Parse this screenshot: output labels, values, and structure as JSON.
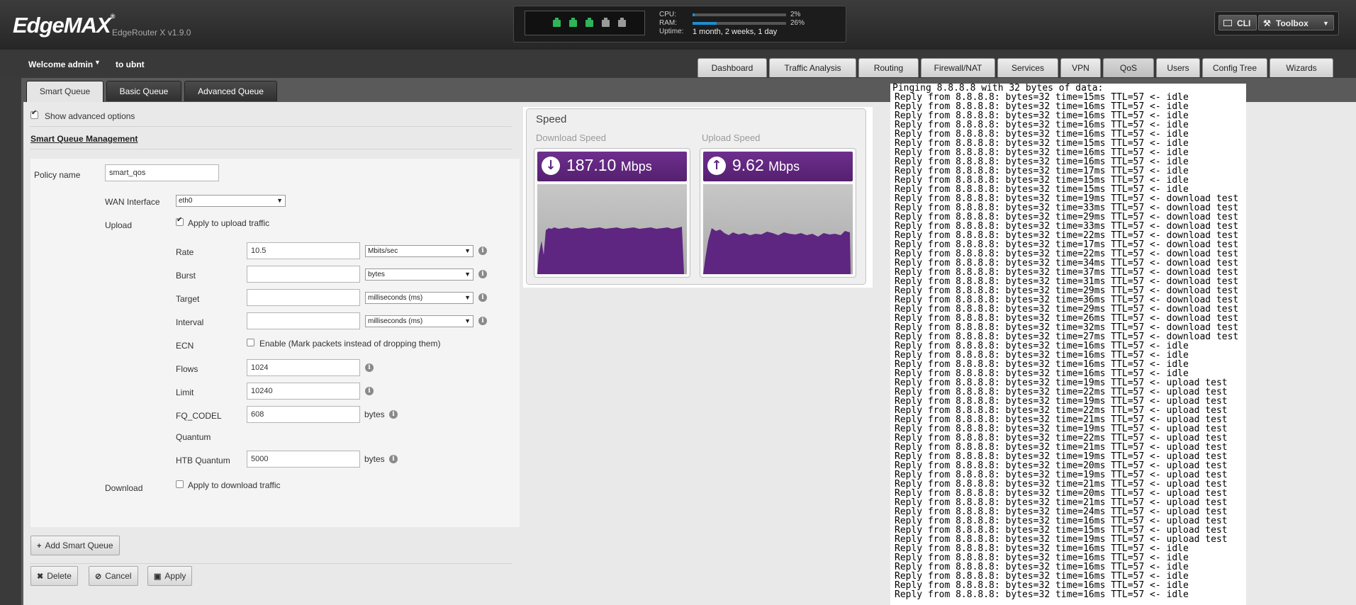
{
  "header": {
    "logo_text": "EdgeMAX",
    "logo_sup": "®",
    "device": "EdgeRouter X v1.9.0",
    "stats": {
      "cpu_label": "CPU:",
      "cpu_pct": "2%",
      "cpu_value": 0.02,
      "ram_label": "RAM:",
      "ram_pct": "26%",
      "ram_value": 0.26,
      "uptime_label": "Uptime:",
      "uptime_value": "1 month, 2 weeks, 1 day"
    },
    "ports": [
      {
        "name": "eth0",
        "color": "#2fb35b"
      },
      {
        "name": "eth1",
        "color": "#2fb35b"
      },
      {
        "name": "eth2",
        "color": "#2fb35b"
      },
      {
        "name": "eth3",
        "color": "#9a9a9a"
      },
      {
        "name": "eth4",
        "color": "#9a9a9a"
      }
    ],
    "cli_label": "CLI",
    "toolbox_label": "Toolbox"
  },
  "subbar": {
    "welcome": "Welcome admin",
    "user_link": "to ubnt",
    "tabs": [
      "Dashboard",
      "Traffic Analysis",
      "Routing",
      "Firewall/NAT",
      "Services",
      "VPN",
      "QoS",
      "Users",
      "Config Tree",
      "Wizards"
    ],
    "active_tab": "QoS"
  },
  "queue_tabs": [
    "Smart Queue",
    "Basic Queue",
    "Advanced Queue"
  ],
  "form": {
    "show_advanced": "Show advanced options",
    "section_title": "Smart Queue Management",
    "policy_label": "Policy name",
    "policy_value": "smart_qos",
    "wan_label": "WAN Interface",
    "wan_value": "eth0",
    "upload_label": "Upload",
    "upload_apply": "Apply to upload traffic",
    "rate_label": "Rate",
    "rate_value": "10.5",
    "rate_unit": "Mbits/sec",
    "burst_label": "Burst",
    "burst_value": "",
    "burst_unit": "bytes",
    "target_label": "Target",
    "target_value": "",
    "target_unit": "milliseconds (ms)",
    "interval_label": "Interval",
    "interval_value": "",
    "interval_unit": "milliseconds (ms)",
    "ecn_label": "ECN",
    "ecn_text": "Enable (Mark packets instead of dropping them)",
    "flows_label": "Flows",
    "flows_value": "1024",
    "limit_label": "Limit",
    "limit_value": "10240",
    "fq_label_1": "FQ_CODEL",
    "fq_label_2": "Quantum",
    "fq_value": "608",
    "fq_unit": "bytes",
    "htb_label": "HTB Quantum",
    "htb_value": "5000",
    "htb_unit": "bytes",
    "download_label": "Download",
    "download_apply": "Apply to download traffic",
    "add_button": "Add Smart Queue",
    "delete_button": "Delete",
    "cancel_button": "Cancel",
    "apply_button": "Apply"
  },
  "speed": {
    "title": "Speed",
    "download_title": "Download Speed",
    "download_value": "187.10",
    "download_unit": "Mbps",
    "upload_title": "Upload Speed",
    "upload_value": "9.62",
    "upload_unit": "Mbps",
    "graph_color": "#5e2680"
  },
  "ping_log": {
    "header": "Pinging 8.8.8.8 with 32 bytes of data:",
    "lines": [
      {
        "time": "15ms",
        "tag": "idle"
      },
      {
        "time": "16ms",
        "tag": "idle"
      },
      {
        "time": "16ms",
        "tag": "idle"
      },
      {
        "time": "16ms",
        "tag": "idle"
      },
      {
        "time": "16ms",
        "tag": "idle"
      },
      {
        "time": "15ms",
        "tag": "idle"
      },
      {
        "time": "16ms",
        "tag": "idle"
      },
      {
        "time": "16ms",
        "tag": "idle"
      },
      {
        "time": "17ms",
        "tag": "idle"
      },
      {
        "time": "15ms",
        "tag": "idle"
      },
      {
        "time": "15ms",
        "tag": "idle"
      },
      {
        "time": "19ms",
        "tag": "download test"
      },
      {
        "time": "33ms",
        "tag": "download test"
      },
      {
        "time": "29ms",
        "tag": "download test"
      },
      {
        "time": "33ms",
        "tag": "download test"
      },
      {
        "time": "22ms",
        "tag": "download test"
      },
      {
        "time": "17ms",
        "tag": "download test"
      },
      {
        "time": "22ms",
        "tag": "download test"
      },
      {
        "time": "34ms",
        "tag": "download test"
      },
      {
        "time": "37ms",
        "tag": "download test"
      },
      {
        "time": "31ms",
        "tag": "download test"
      },
      {
        "time": "29ms",
        "tag": "download test"
      },
      {
        "time": "36ms",
        "tag": "download test"
      },
      {
        "time": "29ms",
        "tag": "download test"
      },
      {
        "time": "26ms",
        "tag": "download test"
      },
      {
        "time": "32ms",
        "tag": "download test"
      },
      {
        "time": "27ms",
        "tag": "download test"
      },
      {
        "time": "16ms",
        "tag": "idle"
      },
      {
        "time": "16ms",
        "tag": "idle"
      },
      {
        "time": "16ms",
        "tag": "idle"
      },
      {
        "time": "16ms",
        "tag": "idle"
      },
      {
        "time": "19ms",
        "tag": "upload test"
      },
      {
        "time": "22ms",
        "tag": "upload test"
      },
      {
        "time": "19ms",
        "tag": "upload test"
      },
      {
        "time": "22ms",
        "tag": "upload test"
      },
      {
        "time": "21ms",
        "tag": "upload test"
      },
      {
        "time": "19ms",
        "tag": "upload test"
      },
      {
        "time": "22ms",
        "tag": "upload test"
      },
      {
        "time": "21ms",
        "tag": "upload test"
      },
      {
        "time": "19ms",
        "tag": "upload test"
      },
      {
        "time": "20ms",
        "tag": "upload test"
      },
      {
        "time": "19ms",
        "tag": "upload test"
      },
      {
        "time": "21ms",
        "tag": "upload test"
      },
      {
        "time": "20ms",
        "tag": "upload test"
      },
      {
        "time": "21ms",
        "tag": "upload test"
      },
      {
        "time": "24ms",
        "tag": "upload test"
      },
      {
        "time": "16ms",
        "tag": "upload test"
      },
      {
        "time": "15ms",
        "tag": "upload test"
      },
      {
        "time": "19ms",
        "tag": "upload test"
      },
      {
        "time": "16ms",
        "tag": "idle"
      },
      {
        "time": "16ms",
        "tag": "idle"
      },
      {
        "time": "16ms",
        "tag": "idle"
      },
      {
        "time": "16ms",
        "tag": "idle"
      },
      {
        "time": "16ms",
        "tag": "idle"
      },
      {
        "time": "16ms",
        "tag": "idle"
      }
    ]
  }
}
